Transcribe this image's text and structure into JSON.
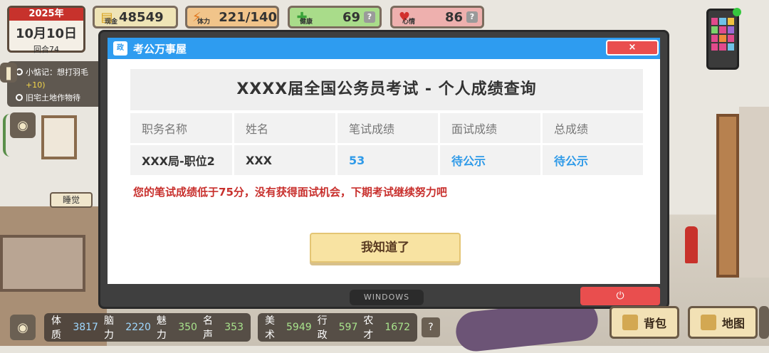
{
  "date": {
    "year": "2025年",
    "day": "10月10日",
    "turn": "回合74"
  },
  "stats": {
    "cash": {
      "label": "现金",
      "value": "48549"
    },
    "energy": {
      "label": "体力",
      "value": "221/140"
    },
    "health": {
      "label": "健康",
      "value": "69"
    },
    "mood": {
      "label": "心情",
      "value": "86"
    }
  },
  "log": {
    "line1": "小惦记：想打羽毛",
    "line1_gain": "+10)",
    "line2": "旧宅土地作物待"
  },
  "room": {
    "sleep_tag": "睡觉"
  },
  "window": {
    "logo": "政",
    "title": "考公万事屋",
    "close": "×",
    "os_label": "WINDOWS",
    "power": "⏻"
  },
  "result": {
    "title": "XXXX届全国公务员考试 - 个人成绩查询",
    "headers": [
      "职务名称",
      "姓名",
      "笔试成绩",
      "面试成绩",
      "总成绩"
    ],
    "row": [
      "XXX局-职位2",
      "XXX",
      "53",
      "待公示",
      "待公示"
    ],
    "message": "您的笔试成绩低于75分，没有获得面试机会，下期考试继续努力吧",
    "ok_button": "我知道了"
  },
  "attrs_left": [
    {
      "name": "体质",
      "value": "3817"
    },
    {
      "name": "脑力",
      "value": "2220"
    },
    {
      "name": "魅力",
      "value": "350"
    },
    {
      "name": "名声",
      "value": "353"
    }
  ],
  "attrs_right": [
    {
      "name": "美术",
      "value": "5949"
    },
    {
      "name": "行政",
      "value": "597"
    },
    {
      "name": "农才",
      "value": "1672"
    }
  ],
  "help": "?",
  "buttons": {
    "bag": "背包",
    "map": "地图"
  }
}
